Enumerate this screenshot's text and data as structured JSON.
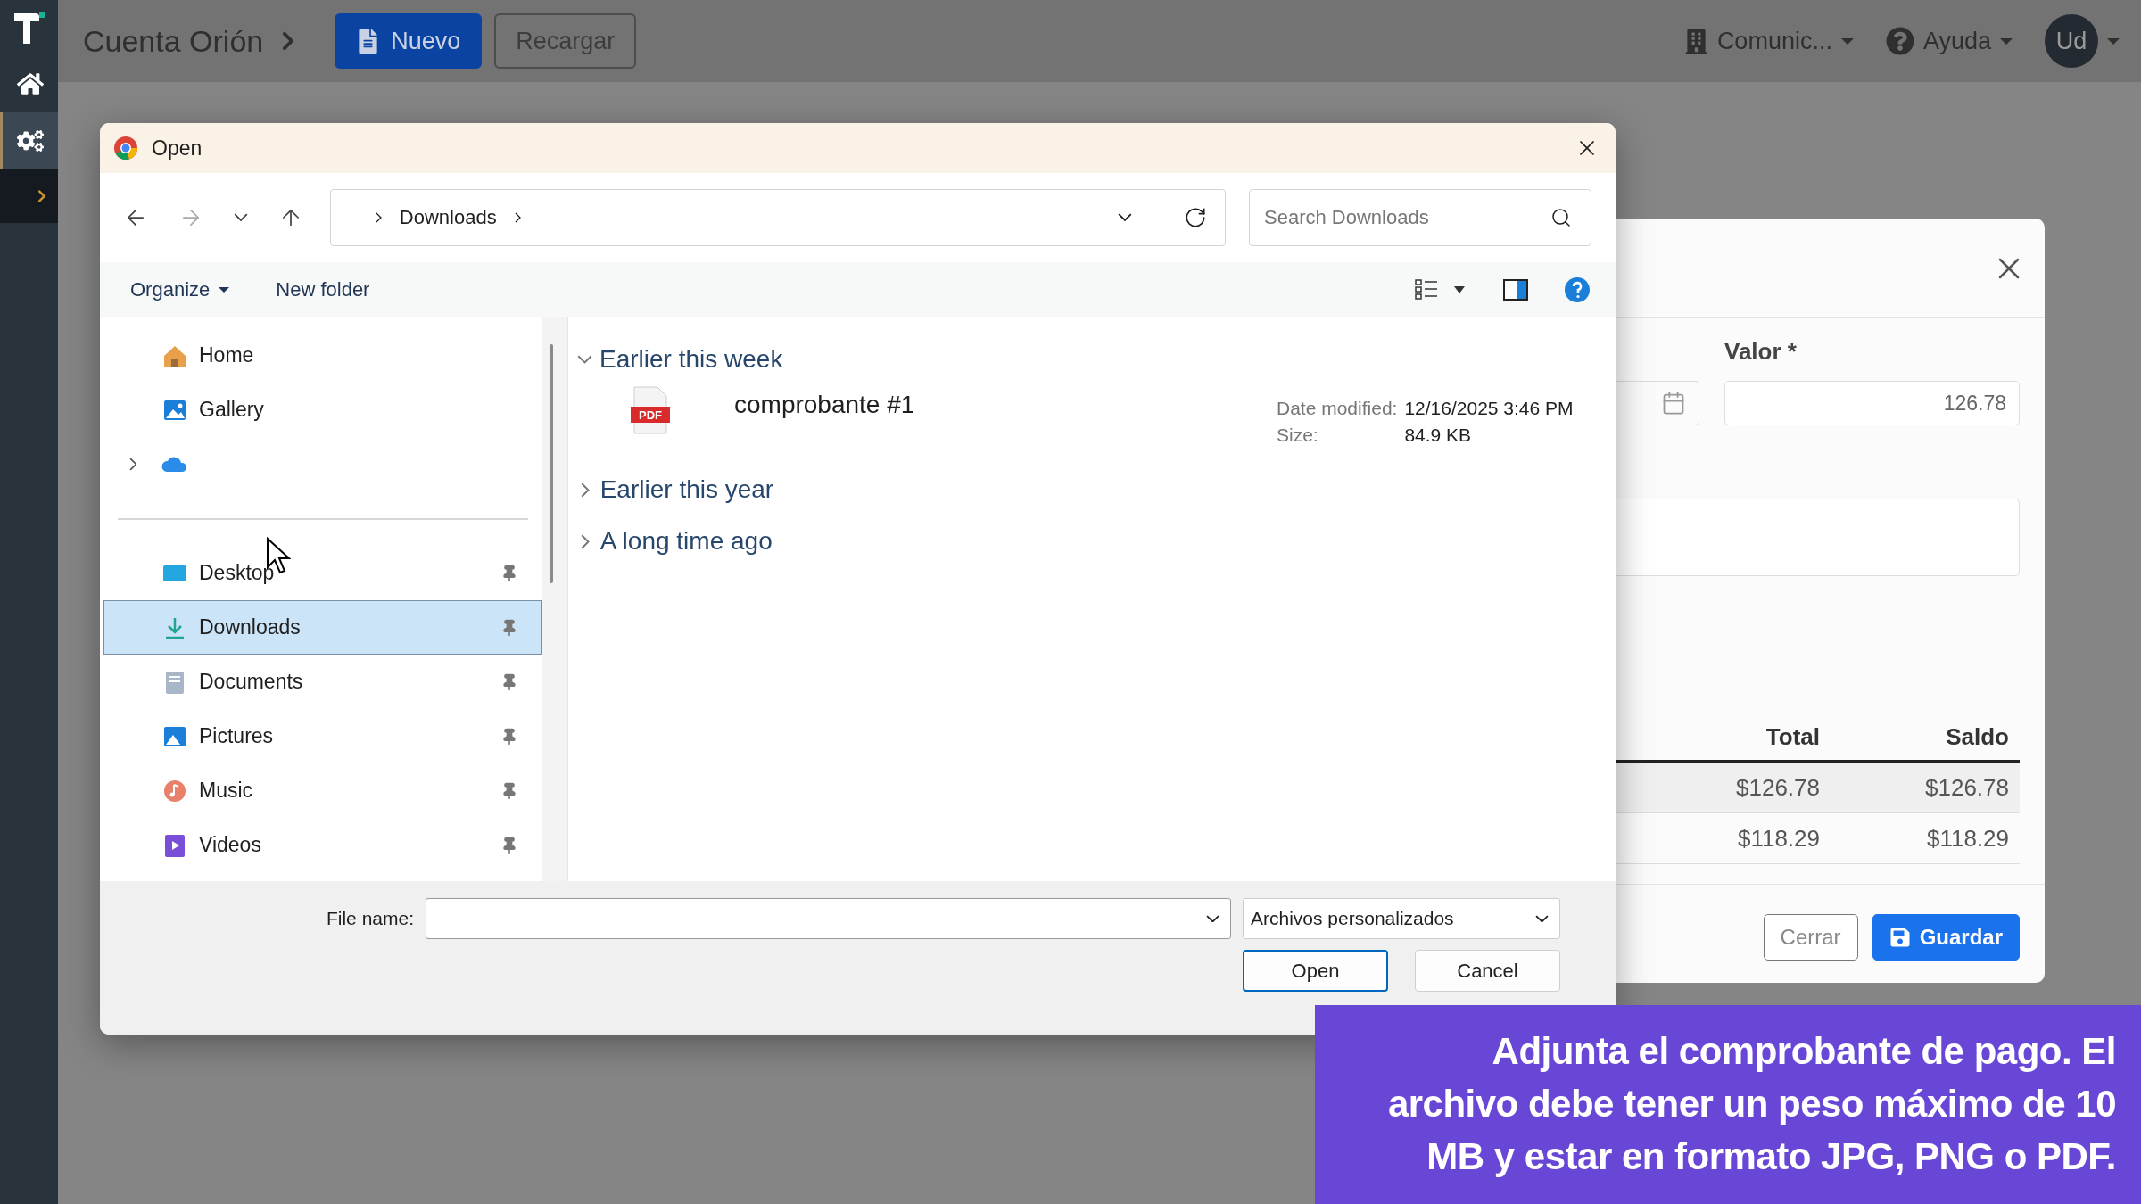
{
  "app": {
    "sidebar": [
      {
        "selected": false
      },
      {
        "selected": true
      }
    ],
    "breadcrumb": "Cuenta Orión",
    "buttons": [
      {
        "label": "Nuevo",
        "kind": "primary"
      },
      {
        "label": "Recargar",
        "kind": "secondary"
      }
    ],
    "company_menu": "Comunic...",
    "help_menu": "Ayuda",
    "avatar": "Ud"
  },
  "modal": {
    "field_label": "Valor *",
    "value": "126.78",
    "table": {
      "columns": [
        "Total",
        "Saldo"
      ],
      "rows": [
        {
          "cells": [
            "$126.78",
            "$126.78"
          ],
          "highlighted": true
        },
        {
          "cells": [
            "$118.29",
            "$118.29"
          ],
          "highlighted": false
        }
      ]
    },
    "buttons": [
      {
        "label": "Cerrar",
        "kind": "secondary"
      },
      {
        "label": "Guardar",
        "kind": "primary"
      }
    ]
  },
  "dialog": {
    "title": "Open",
    "nav_buttons": [
      {
        "disabled": false
      },
      {
        "disabled": true
      },
      {
        "disabled": false
      },
      {
        "disabled": false
      }
    ],
    "address": [
      "Downloads"
    ],
    "search": {
      "placeholder": "Search Downloads"
    },
    "commands": [
      "Organize",
      "New folder"
    ],
    "nav": [
      {
        "kind": "home",
        "label": "Home",
        "selected": false,
        "pinned": false
      },
      {
        "kind": "gallery",
        "label": "Gallery",
        "selected": false,
        "pinned": false
      },
      {
        "kind": "cloud",
        "selected": false,
        "pinned": false
      },
      {
        "kind": "separator"
      },
      {
        "kind": "desktop",
        "label": "Desktop",
        "selected": false,
        "pinned": true
      },
      {
        "kind": "downloads",
        "label": "Downloads",
        "selected": true,
        "pinned": true
      },
      {
        "kind": "documents",
        "label": "Documents",
        "selected": false,
        "pinned": true
      },
      {
        "kind": "pictures",
        "label": "Pictures",
        "selected": false,
        "pinned": true
      },
      {
        "kind": "music",
        "label": "Music",
        "selected": false,
        "pinned": true
      },
      {
        "kind": "videos",
        "label": "Videos",
        "selected": false,
        "pinned": true
      }
    ],
    "groups": [
      {
        "label": "Earlier this week",
        "expanded": true,
        "files": [
          {
            "name": "comprobante #1",
            "icon_label": "PDF",
            "date_label": "Date modified:",
            "date": "12/16/2025 3:46 PM",
            "size_label": "Size:",
            "size": "84.9 KB"
          }
        ]
      },
      {
        "label": "Earlier this year",
        "expanded": false
      },
      {
        "label": "A long time ago",
        "expanded": false
      }
    ],
    "file_name": {
      "label": "File name:"
    },
    "file_type": "Archivos personalizados",
    "buttons": [
      {
        "label": "Open",
        "kind": "default"
      },
      {
        "label": "Cancel",
        "kind": "normal"
      }
    ]
  },
  "caption": "Adjunta el comprobante de pago. El archivo debe tener un peso máximo de 10 MB y estar en formato JPG, PNG o PDF."
}
